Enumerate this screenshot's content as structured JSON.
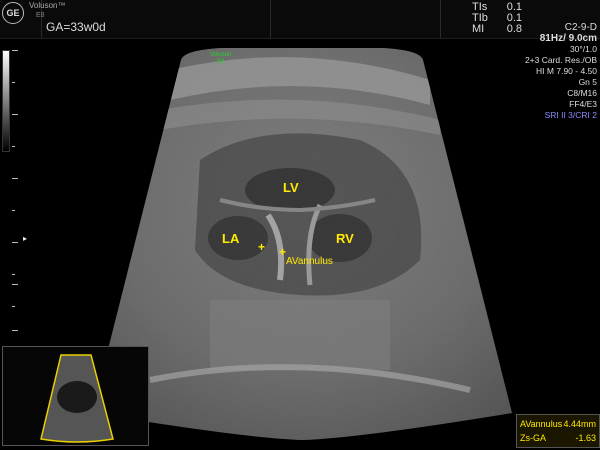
{
  "header": {
    "brand_logo_text": "GE",
    "brand_name": "Voluson™",
    "brand_model": "E8",
    "ga_label": "GA=33w0d",
    "indices": [
      {
        "key": "TIs",
        "value": "0.1"
      },
      {
        "key": "TIb",
        "value": "0.1"
      },
      {
        "key": "MI",
        "value": "0.8"
      }
    ]
  },
  "params": {
    "probe": "C2-9-D",
    "frame_depth": "81Hz/ 9.0cm",
    "angle": "30°/1.0",
    "mode": "2+3 Card. Res./OB",
    "harmonic": "HI M 7.90 - 4.50",
    "gain": "Gn 5",
    "cmap": "C8/M16",
    "ff": "FF4/E3",
    "sri": "SRI II 3/CRI 2"
  },
  "image_logo": {
    "line1": "Voluson",
    "line2": "E8"
  },
  "labels": {
    "lv": "LV",
    "la": "LA",
    "rv": "RV",
    "annulus": "AVannulus",
    "caliper": "+"
  },
  "measurements": [
    {
      "name": "AVannulus",
      "value": "4.44mm"
    },
    {
      "name": "Zs-GA",
      "value": "-1.63"
    }
  ],
  "colors": {
    "annotation": "#ffea00",
    "sri": "#8c8cff",
    "logo_green": "#2cd12c"
  }
}
